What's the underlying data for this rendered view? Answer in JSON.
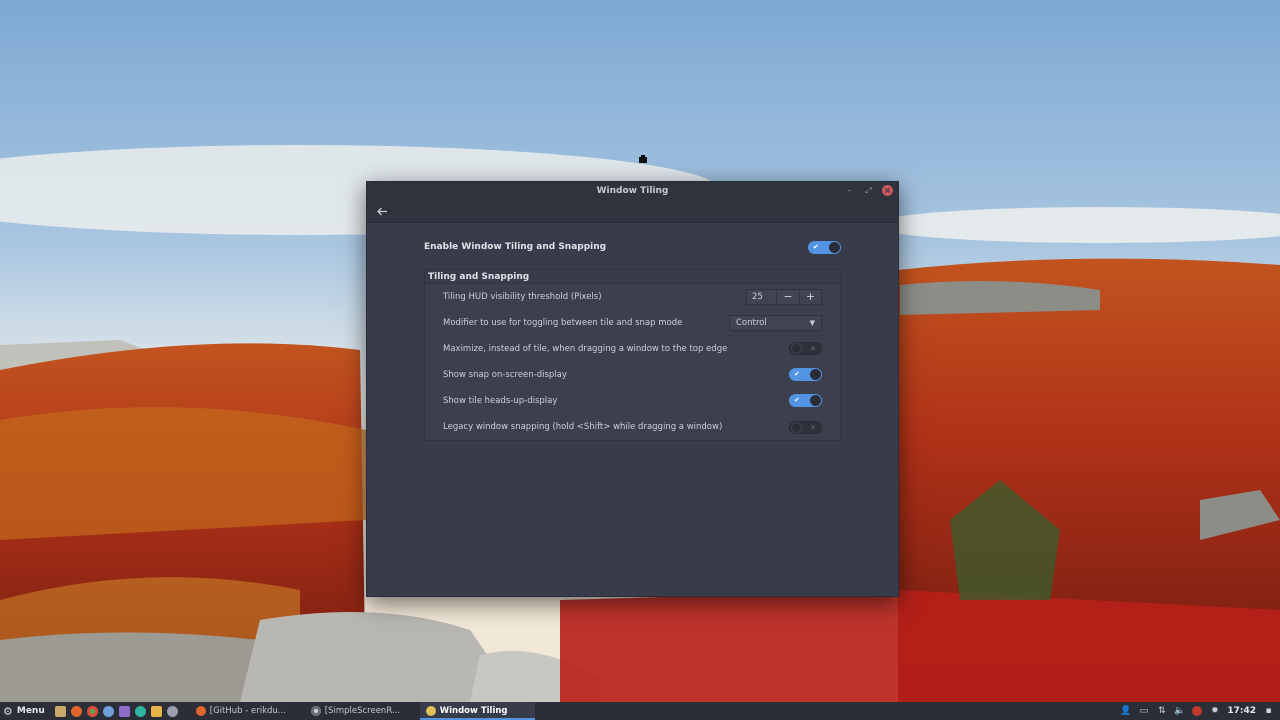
{
  "window": {
    "title": "Window Tiling",
    "enable_label": "Enable Window Tiling and Snapping",
    "enable_on": true
  },
  "section": {
    "title": "Tiling and Snapping",
    "rows": {
      "hud_threshold": {
        "label": "Tiling HUD visibility threshold (Pixels)",
        "value": "25",
        "minus": "−",
        "plus": "+"
      },
      "modifier": {
        "label": "Modifier to use for toggling between tile and snap mode",
        "value": "Control"
      },
      "maximize": {
        "label": "Maximize, instead of tile, when dragging a window to the top edge",
        "on": false
      },
      "snap_osd": {
        "label": "Show snap on-screen-display",
        "on": true
      },
      "tile_hud": {
        "label": "Show tile heads-up-display",
        "on": true
      },
      "legacy": {
        "label": "Legacy window snapping (hold <Shift> while dragging a window)",
        "on": false
      }
    }
  },
  "icons": {
    "back": "back-arrow-icon",
    "minimize": "minimize-icon",
    "maximize": "maximize-icon",
    "close": "close-icon"
  },
  "taskbar": {
    "menu_label": "Menu",
    "tasks": [
      {
        "label": "[GitHub - erikdu...",
        "active": false
      },
      {
        "label": "[SimpleScreenR...",
        "active": false
      },
      {
        "label": "Window Tiling",
        "active": true
      }
    ],
    "clock": "17:42"
  },
  "colors": {
    "accent": "#5294e2",
    "window_bg": "#383c4a",
    "close": "#cc575d"
  }
}
